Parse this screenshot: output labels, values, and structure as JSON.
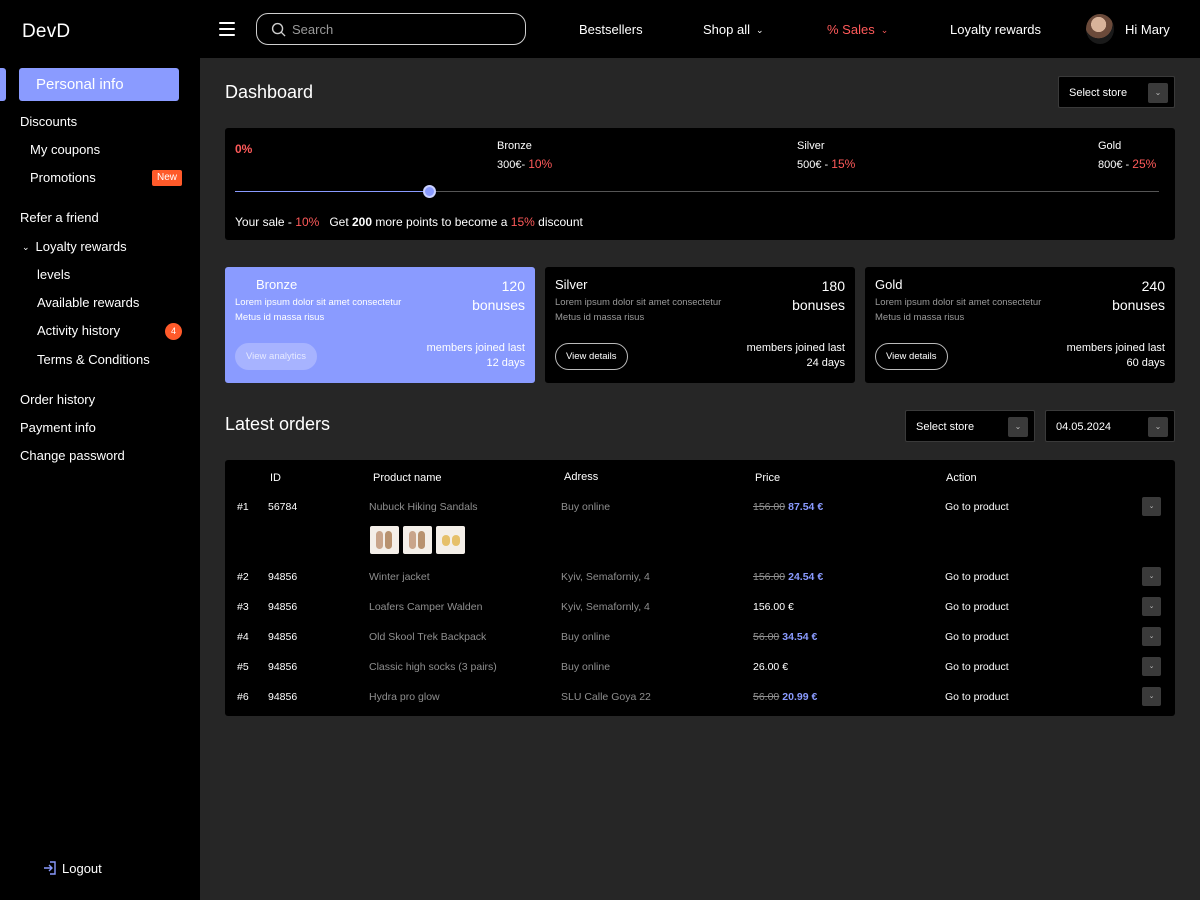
{
  "header": {
    "logo": "DevD",
    "search_placeholder": "Search",
    "nav": {
      "bestsellers": "Bestsellers",
      "shop_all": "Shop all",
      "sales": "% Sales",
      "loyalty": "Loyalty  rewards"
    },
    "greeting": "Hi Mary"
  },
  "sidebar": {
    "personal_info": "Personal info",
    "discounts": "Discounts",
    "my_coupons": "My coupons",
    "promotions": "Promotions",
    "promotions_badge": "New",
    "refer": "Refer a friend",
    "loyalty_rewards": "Loyalty rewards",
    "levels": "levels",
    "available_rewards": "Available rewards",
    "activity_history": "Activity history",
    "activity_badge": "4",
    "terms": "Terms & Conditions",
    "order_history": "Order history",
    "payment_info": "Payment info",
    "change_password": "Change password",
    "logout": "Logout"
  },
  "dashboard": {
    "title": "Dashboard",
    "select_store": "Select store"
  },
  "progress": {
    "start": "0%",
    "fill_fraction": 0.21,
    "tiers": [
      {
        "name": "Bronze",
        "price": "300€-",
        "pct": "10%"
      },
      {
        "name": "Silver",
        "price": "500€ -",
        "pct": "15%"
      },
      {
        "name": "Gold",
        "price": "800€ -",
        "pct": "25%"
      }
    ],
    "sale_label": "Your sale - ",
    "sale_value": "10%",
    "get_prefix": "Get ",
    "points": "200",
    "get_middle": " more points to become a ",
    "discount_value": "15%",
    "get_suffix": " discount"
  },
  "bonus_cards": [
    {
      "name": "Bronze",
      "desc1": "Lorem ipsum dolor sit amet consectetur",
      "desc2": "Metus id massa risus",
      "count": "120",
      "unit": "bonuses",
      "button": "View analytics",
      "meta1": "members joined last",
      "meta2": "12 days"
    },
    {
      "name": "Silver",
      "desc1": "Lorem ipsum dolor sit amet consectetur",
      "desc2": "Metus id massa risus",
      "count": "180",
      "unit": "bonuses",
      "button": "View details",
      "meta1": "members joined last",
      "meta2": "24 days"
    },
    {
      "name": "Gold",
      "desc1": "Lorem ipsum dolor sit amet consectetur",
      "desc2": "Metus id massa risus",
      "count": "240",
      "unit": "bonuses",
      "button": "View details",
      "meta1": "members joined last",
      "meta2": "60 days"
    }
  ],
  "orders": {
    "title": "Latest orders",
    "select_store": "Select store",
    "date": "04.05.2024",
    "columns": {
      "id": "ID",
      "product": "Product name",
      "address": "Adress",
      "price": "Price",
      "action": "Action"
    },
    "rows": [
      {
        "num": "#1",
        "id": "56784",
        "product": "Nubuck Hiking Sandals",
        "address": "Buy online",
        "old_price": "156.00",
        "price": "87.54 €",
        "action": "Go to product"
      },
      {
        "num": "#2",
        "id": "94856",
        "product": "Winter jacket",
        "address": "Kyiv, Semaforniy, 4",
        "old_price": "156.00",
        "price": "24.54 €",
        "action": "Go to product"
      },
      {
        "num": "#3",
        "id": "94856",
        "product": "Loafers Camper Walden",
        "address": "Kyiv, Semafornly, 4",
        "old_price": "",
        "price": "156.00 €",
        "action": "Go to product"
      },
      {
        "num": "#4",
        "id": "94856",
        "product": "Old Skool Trek Backpack",
        "address": "Buy online",
        "old_price": "56.00",
        "price": "34.54 €",
        "action": "Go to product"
      },
      {
        "num": "#5",
        "id": "94856",
        "product": "Classic high socks (3 pairs)",
        "address": "Buy online",
        "old_price": "",
        "price": "26.00 €",
        "action": "Go to product"
      },
      {
        "num": "#6",
        "id": "94856",
        "product": "Hydra pro glow",
        "address": "SLU Calle Goya 22",
        "old_price": "56.00",
        "price": "20.99 €",
        "action": "Go to product"
      }
    ]
  },
  "colors": {
    "accent": "#8a9bff",
    "sale_red": "#ff5a5a",
    "badge_orange": "#ff5a2a"
  }
}
